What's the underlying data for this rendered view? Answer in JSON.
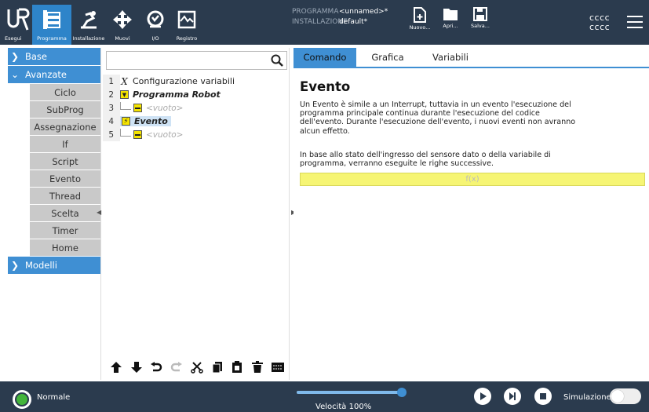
{
  "topbar": {
    "nav": [
      {
        "label": "Esegui",
        "icon": "run-icon"
      },
      {
        "label": "Programma",
        "icon": "program-icon"
      },
      {
        "label": "Installazione",
        "icon": "installation-icon"
      },
      {
        "label": "Muovi",
        "icon": "move-icon"
      },
      {
        "label": "I/O",
        "icon": "io-icon"
      },
      {
        "label": "Registro",
        "icon": "log-icon"
      }
    ],
    "programma_label": "PROGRAMMA",
    "programma_value": "<unnamed>*",
    "installazione_label": "INSTALLAZIONE",
    "installazione_value": "default*",
    "file_buttons": [
      {
        "label": "Nuovo...",
        "icon": "new-file-icon"
      },
      {
        "label": "Apri...",
        "icon": "open-folder-icon"
      },
      {
        "label": "Salva...",
        "icon": "save-icon"
      }
    ],
    "user_line1": "cccc",
    "user_line2": "cccc"
  },
  "left_panel": {
    "base": "Base",
    "avanzate": "Avanzate",
    "items": [
      "Ciclo",
      "SubProg",
      "Assegnazione",
      "If",
      "Script",
      "Evento",
      "Thread",
      "Scelta",
      "Timer",
      "Home"
    ],
    "modelli": "Modelli"
  },
  "program_tree": {
    "search_placeholder": "",
    "nodes": [
      {
        "line": "1",
        "text": "Configurazione variabili"
      },
      {
        "line": "2",
        "text": "Programma Robot"
      },
      {
        "line": "3",
        "text": "<vuoto>"
      },
      {
        "line": "4",
        "text": "Evento"
      },
      {
        "line": "5",
        "text": "<vuoto>"
      }
    ]
  },
  "tabs": [
    "Comando",
    "Grafica",
    "Variabili"
  ],
  "content": {
    "heading": "Evento",
    "para1": "Un Evento è simile a un Interrupt, tuttavia in un evento l'esecuzione del programma principale continua durante l'esecuzione del codice dell'evento. Durante l'esecuzione dell'evento, i nuovi eventi non avranno alcun effetto.",
    "para2": "In base allo stato dell'ingresso del sensore dato o della variabile di programma, verranno eseguite le righe successive.",
    "expression_placeholder": "f(x)"
  },
  "bottombar": {
    "status": "Normale",
    "speed_label": "Velocità 100%",
    "speed_value": 100,
    "simulation_label": "Simulazione",
    "simulation_on": false
  },
  "colors": {
    "topbar": "#2b3b4e",
    "accent": "#3f8fd3",
    "status_green": "#43b53a",
    "expression_yellow": "#f6f574"
  }
}
